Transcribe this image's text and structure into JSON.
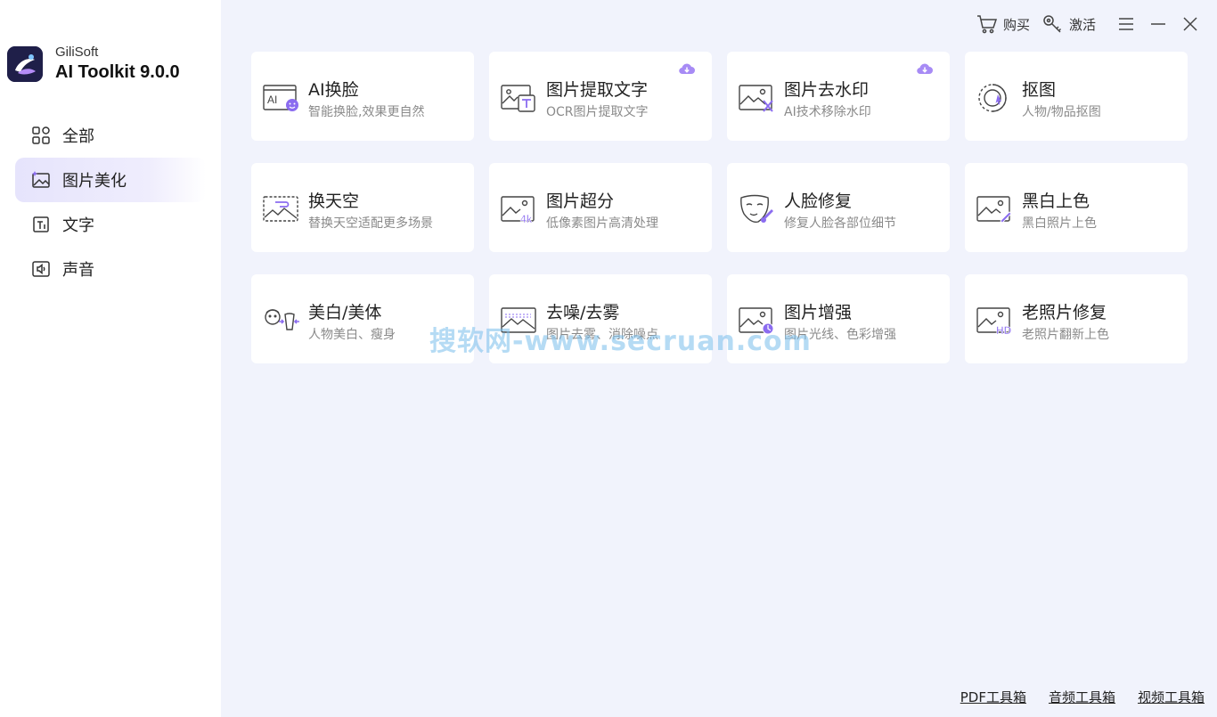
{
  "brand": {
    "subtitle": "GiliSoft",
    "title": "AI Toolkit 9.0.0"
  },
  "nav": [
    {
      "label": "全部",
      "icon": "grid-icon"
    },
    {
      "label": "图片美化",
      "icon": "image-icon"
    },
    {
      "label": "文字",
      "icon": "text-icon"
    },
    {
      "label": "声音",
      "icon": "sound-icon"
    }
  ],
  "topbar": {
    "buy": "购买",
    "activate": "激活"
  },
  "cards": [
    {
      "title": "AI换脸",
      "desc": "智能换脸,效果更自然",
      "icon": "ai-face-swap-icon"
    },
    {
      "title": "图片提取文字",
      "desc": "OCR图片提取文字",
      "icon": "ocr-icon",
      "download": true
    },
    {
      "title": "图片去水印",
      "desc": "AI技术移除水印",
      "icon": "watermark-remove-icon",
      "download": true
    },
    {
      "title": "抠图",
      "desc": "人物/物品抠图",
      "icon": "cutout-icon"
    },
    {
      "title": "换天空",
      "desc": "替换天空适配更多场景",
      "icon": "sky-replace-icon"
    },
    {
      "title": "图片超分",
      "desc": "低像素图片高清处理",
      "icon": "upscale-4k-icon"
    },
    {
      "title": "人脸修复",
      "desc": "修复人脸各部位细节",
      "icon": "face-restore-icon"
    },
    {
      "title": "黑白上色",
      "desc": "黑白照片上色",
      "icon": "colorize-icon"
    },
    {
      "title": "美白/美体",
      "desc": "人物美白、瘦身",
      "icon": "beautify-icon"
    },
    {
      "title": "去噪/去雾",
      "desc": "图片去雾、消除噪点",
      "icon": "denoise-icon"
    },
    {
      "title": "图片增强",
      "desc": "图片光线、色彩增强",
      "icon": "enhance-icon"
    },
    {
      "title": "老照片修复",
      "desc": "老照片翻新上色",
      "icon": "old-photo-hd-icon"
    }
  ],
  "watermark": "搜软网-www.secruan.com",
  "bottom_links": [
    "PDF工具箱",
    "音频工具箱",
    "视频工具箱"
  ],
  "colors": {
    "accent": "#8b6cf0",
    "background": "#f1f3fc",
    "sidebar": "#ffffff"
  }
}
